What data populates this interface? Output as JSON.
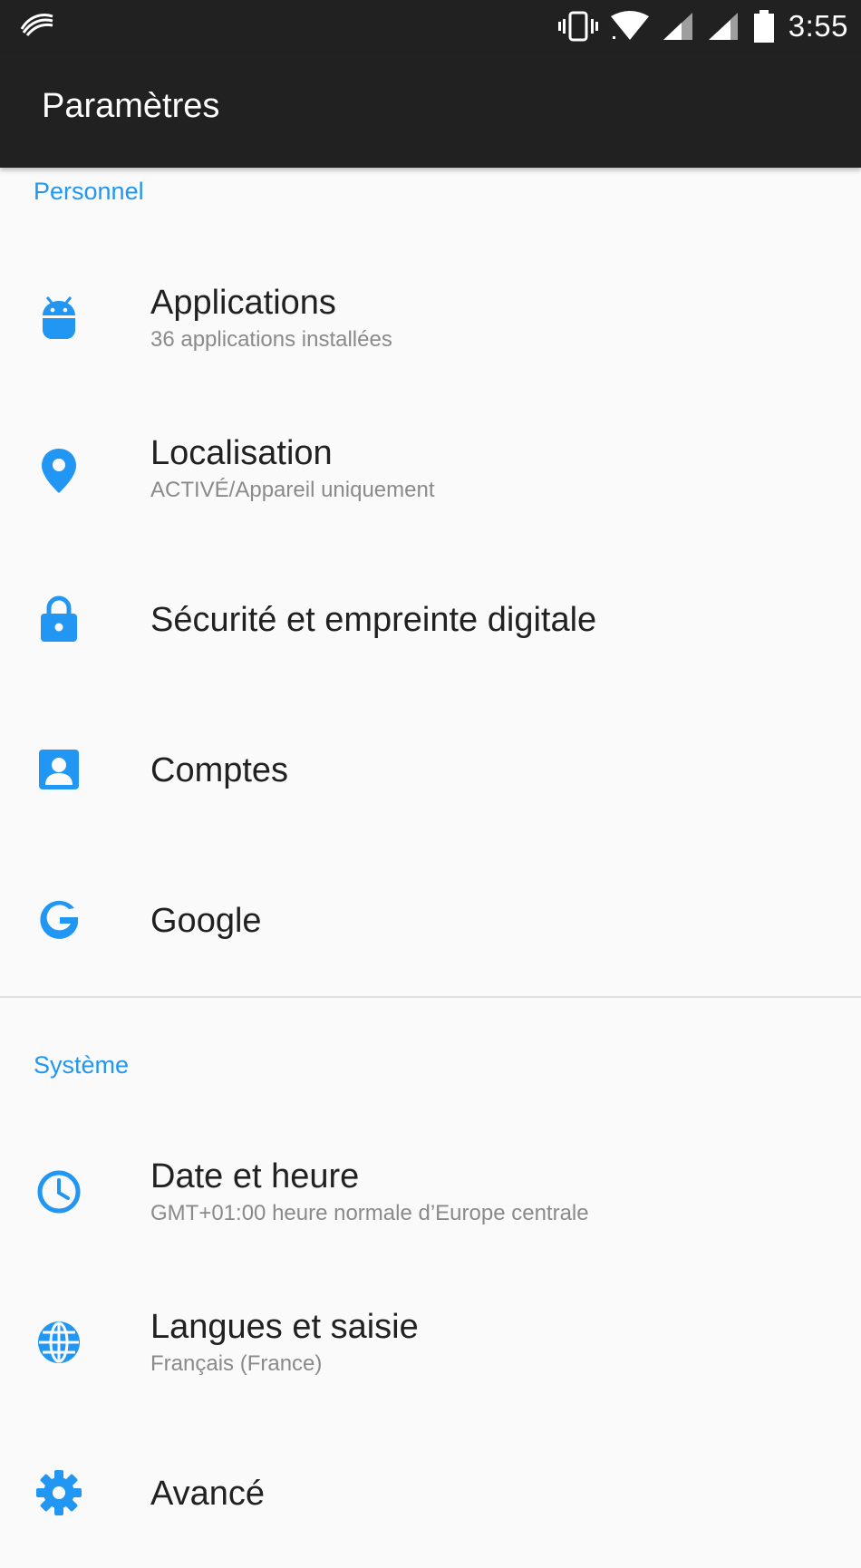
{
  "status_bar": {
    "time": "3:55",
    "icons": [
      "swiftkey-icon",
      "vibrate-icon",
      "wifi-icon",
      "signal-icon",
      "signal-icon-2",
      "battery-icon"
    ]
  },
  "app_bar": {
    "title": "Paramètres"
  },
  "colors": {
    "accent": "#2196f3",
    "status_bar": "#212121",
    "background": "#fafafa"
  },
  "sections": [
    {
      "header": "Personnel",
      "items": [
        {
          "icon": "android-icon",
          "title": "Applications",
          "subtitle": "36 applications installées"
        },
        {
          "icon": "location-pin-icon",
          "title": "Localisation",
          "subtitle": "ACTIVÉ/Appareil uniquement"
        },
        {
          "icon": "lock-icon",
          "title": "Sécurité et empreinte digitale",
          "subtitle": ""
        },
        {
          "icon": "account-box-icon",
          "title": "Comptes",
          "subtitle": ""
        },
        {
          "icon": "google-icon",
          "title": "Google",
          "subtitle": ""
        }
      ]
    },
    {
      "header": "Système",
      "items": [
        {
          "icon": "clock-icon",
          "title": "Date et heure",
          "subtitle": "GMT+01:00 heure normale d’Europe centrale"
        },
        {
          "icon": "globe-icon",
          "title": "Langues et saisie",
          "subtitle": "Français (France)"
        },
        {
          "icon": "gear-icon",
          "title": "Avancé",
          "subtitle": ""
        }
      ]
    }
  ]
}
